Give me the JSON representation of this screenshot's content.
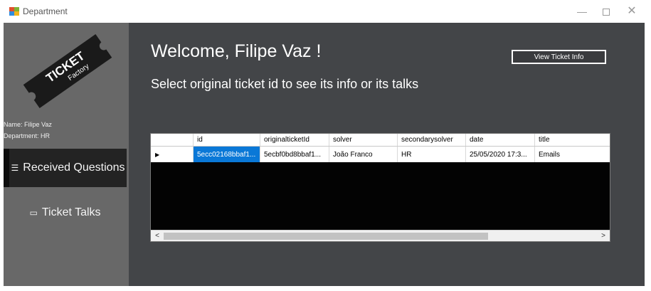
{
  "window": {
    "title": "Department",
    "minimize_glyph": "—",
    "close_glyph": "✕"
  },
  "sidebar": {
    "logo_text_line1": "TICKET",
    "logo_text_line2": "Factory",
    "user_name": "Name: Filipe Vaz",
    "user_department": "Department: HR",
    "nav": [
      {
        "label": "Received Questions",
        "icon": "received-questions-icon",
        "active": true
      },
      {
        "label": "Ticket Talks",
        "icon": "ticket-talks-icon",
        "active": false
      }
    ]
  },
  "main": {
    "welcome": "Welcome, Filipe Vaz !",
    "subtitle": "Select original ticket id to see its info or its talks",
    "view_button": "View Ticket Info"
  },
  "grid": {
    "columns": [
      "id",
      "originalticketId",
      "solver",
      "secondarysolver",
      "date",
      "title"
    ],
    "rows": [
      [
        "5ecc02168bbaf1...",
        "5ecbf0bd8bbaf1...",
        "João Franco",
        "HR",
        "25/05/2020 17:3...",
        "Emails"
      ]
    ],
    "selected_row_marker": "▶",
    "scroll_left": "<",
    "scroll_right": ">"
  }
}
